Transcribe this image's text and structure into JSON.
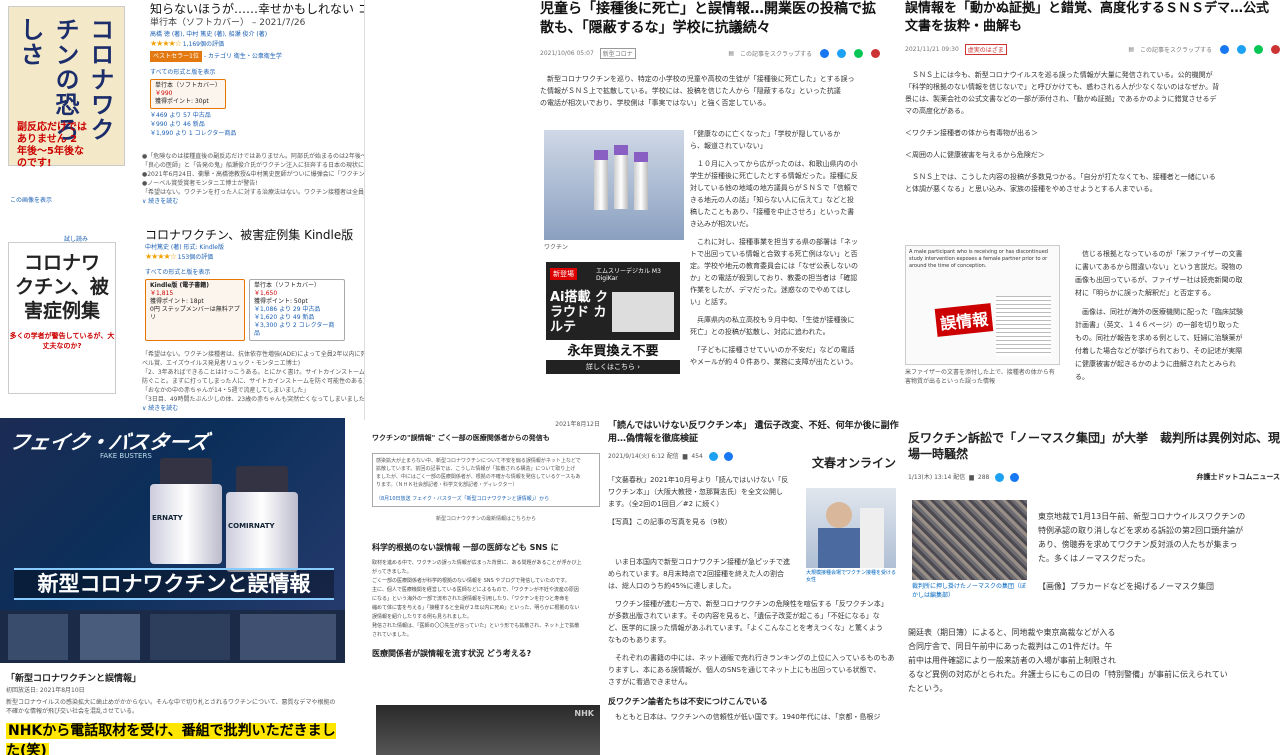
{
  "panelA": {
    "book1": {
      "cover_title": "コロナワクチンの恐ろしさ",
      "cover_sub": "副反応だけではありません 2年後～5年後なのです!",
      "title": "知らないほうが……幸せかもしれない コロナワクチンの恐ろしさ",
      "format_line": "単行本（ソフトカバー） – 2021/7/26",
      "authors": "高橋 徳 (著), 中村 篤史 (著), 船瀬 俊介 (著)",
      "rating_count": "1,169個の評価",
      "badge": "ベストセラー1位",
      "category": "- カテゴリ 衛生・公衆衛生学",
      "all_formats": "すべての形式と版を表示",
      "format_box": "単行本（ソフトカバー）",
      "price": "￥990",
      "points": "獲得ポイント: 30pt",
      "used": [
        "￥469 より 57 中古品",
        "￥990 より 46 新品",
        "￥1,990 より 1 コレクター商品"
      ],
      "desc": [
        "●「危険なのは接種直後の副反応だけではありません。阿部氏が始まるのは2年後～5年後なのです!」…危険性を叫ぶ2人の",
        "「良心の医師」と「告発の鬼」船瀬俊介氏がワクチン注入に狂奔する日本の現状に心底から警鐘：コロナワクチンの安全性への重大",
        "●2021年6月24日、衝撃・高橋徳教授&中村篤史医師がついに爆弾会に「ワクチン接種停止」を緊急申し入れ!",
        "●ノーベル賞受賞者モンタニエ博士が警告!",
        "「希望はない。ワクチンを打った人に対する治療法はない。ワクチン接種者は全員2年以内に死ぬ…"
      ],
      "more": "∨ 続きを読む",
      "see_image": "この画像を表示"
    },
    "book2": {
      "sample_label": "試し読み",
      "cover_title": "コロナワクチン、被害症例集",
      "cover_sub": "多くの学者が警告しているが、大丈夫なのか?",
      "title": "コロナワクチン、被害症例集 Kindle版",
      "authors": "中村篤史 (著)   形式: Kindle版",
      "rating_count": "153個の評価",
      "all_formats": "すべての形式と版を表示",
      "kindle_box": "Kindle版 (電子書籍)",
      "kindle_price": "￥1,815",
      "kindle_points": "獲得ポイント: 18pt",
      "unlimited": "0円 ステップメンバーは無料アプリ",
      "paper_box": "単行本（ソフトカバー）",
      "paper_price": "￥1,650",
      "paper_points": "獲得ポイント: 50pt",
      "used": [
        "￥1,086 より 29 中古品",
        "￥1,620 より 49 新品",
        "￥3,300 より 2 コレクター商品"
      ],
      "desc": [
        "「希望はない。ワクチン接種者は、抗体依存性増強(ADE)によって全員2年以内に死亡する。もはや他に話すべきことはない」(ノー",
        "ベル賞、エイズウイルス発見者リュック・モンタニエ博士)",
        "「2、3年あればできることはけっこうある。とにかく書け。サイトカインストームを抑え込むために、免疫の改善によって発症を",
        "防ぐこと。まずに打ってしまった人に、サイトカインストームを防ぐ可能性のある方法を紹介します」(中村篤史)",
        "「おなかの中の赤ちゃんが14・5週で流産してしまいました」",
        "「3日目、49時間たぶん少しの体、23歳の赤ちゃんも突然亡くなってしまいました」"
      ],
      "more": "∨ 続きを読む"
    }
  },
  "panelB": {
    "headline": "児童ら「接種後に死亡」と誤情報…開業医の投稿で拡散も、「隠蔽するな」学校に抗議続々",
    "date": "2021/10/06 05:07",
    "tag": "新型コロナ",
    "clip": "この記事をスクラップする",
    "lead": [
      "　新型コロナワクチンを巡り、特定の小学校の児童や高校の生徒が「接種後に死亡した」とする誤っ",
      "た情報がＳＮＳ上で拡散している。学校には、投稿を信じた人から「隠蔽するな」といった抗議",
      "の電話が相次いでおり、学校側は「事実ではない」と強く否定している。"
    ],
    "body": [
      "「健康なのに亡くなった」「学校が隠しているか",
      "ら、報道されていない」",
      "",
      "　１０月に入ってから広がったのは、和歌山県内の小",
      "学生が接種後に死亡したとする情報だった。接種に反",
      "対している他の地域の地方議員らがＳＮＳで「信頼で",
      "きる地元の人の話」「知らない人に伝えて」などと投",
      "稿したこともあり、「接種を中止させろ」といった書",
      "き込みが相次いだ。",
      "",
      "　これに対し、接種事業を担当する県の部署は「ネッ",
      "トで出回っている情報と合致する死亡例はない」と否",
      "定。学校や地元の教育委員会には「なぜ公表しないの",
      "か」との電話が殺到しており、教委の担当者は「確認",
      "作業をしたが、デマだった。迷惑なのでやめてほし",
      "い」と話す。",
      "",
      "　兵庫県内の私立高校も９月中旬、「生徒が接種後に",
      "死亡」との投稿が拡散し、対応に追われた。",
      "",
      "　「子どもに接種させていいのか不安だ」などの電話",
      "やメールが約４０件あり、業務に支障が出たという。"
    ],
    "photo_caption": "ワクチン",
    "ad_new": "新登場",
    "ad_brand": "エムスリーデジカル M3 DigiKar",
    "ad_main": "Ai搭載 クラウド カルテ",
    "ad_slogan": "永年買換え不要",
    "ad_more": "詳しくはこちら ›"
  },
  "panelC": {
    "headline": "誤情報を「動かぬ証拠」と錯覚、高度化するＳＮＳデマ…公式文書を抜粋・曲解も",
    "date": "2021/11/21 09:30",
    "tag": "虚実のはざま",
    "clip": "この記事をスクラップする",
    "lead": [
      "　ＳＮＳ上には今も、新型コロナウイルスを巡る誤った情報が大量に発信されている。公的機関が",
      "「科学的根拠のない情報を信じないで」と呼びかけても、惑わされる人が少なくないのはなぜか。背",
      "景には、製薬会社の公式文書などの一部が添付され、「動かぬ証拠」であるかのように錯覚させるデ",
      "マの高度化がある。"
    ],
    "quotes": [
      "＜ワクチン接種者の体から有毒物が出る＞",
      "＜周囲の人に健康被害を与えるから危険だ＞"
    ],
    "para2": [
      "　ＳＮＳ上では、こうした内容の投稿が多数見つかる。「自分が打たなくても、接種者と一緒にいる",
      "と体調が悪くなる」と思い込み、家族の接種をやめさせようとする人までいる。"
    ],
    "doc_text": "A male participant who is receiving or has discontinued study intervention exposes a female partner prior to or around the time of conception.",
    "doc_stamp": "誤情報",
    "doc_caption": "米ファイザーの文書を添付した上で、接種者の体から有害物質が出るといった誤った情報",
    "right_text": [
      "　信じる根拠となっているのが「米ファイザーの文書",
      "に書いてあるから間違いない」という言説だ。現物の",
      "画像も出回っているが、ファイザー社は読売新聞の取",
      "材に「明らかに誤った解釈だ」と否定する。",
      "",
      "　画像は、同社が海外の医療機関に配った「臨床試験",
      "計画書」（英文、１４６ページ）の一部を切り取った",
      "もの。同社が報告を求める例として、妊婦に治験薬が",
      "付着した場合などが挙げられており、その記述が実際",
      "に健康被害が起きるかのように曲解されたとみられ",
      "る。"
    ]
  },
  "panelD": {
    "logo": "フェイク・バスターズ",
    "logo_en": "FAKE BUSTERS",
    "vial1": "ERNATY",
    "vial2": "COMIRNATY",
    "banner": "新型コロナワクチンと誤情報",
    "program_title": "「新型コロナワクチンと誤情報」",
    "date": "初回放送日: 2021年8月10日",
    "desc": "新型コロナウイルスの感染拡大に歯止めがかからない。そんな中で切り札とされるワクチンについて、悪質なデマや根拠の不確かな情報が飛び交い社会を混乱させている。",
    "highlight": "NHKから電話取材を受け、番組で批判いただきました(笑)"
  },
  "panelE": {
    "date": "2021年8月12日",
    "title": "ワクチンの\"誤情報\" ごく一部の医療関係者からの発信も",
    "box": [
      "感染拡大が止まらない中、新型コロナワクチンについて不安を煽る誤情報がネット上などで",
      "拡散しています。前回の記事では、こうした情報が「拡散される構造」について取り上げ",
      "ましたが、中にはごく一部の医療関係者が、根拠の不確かな情報を発信しているケースもあ",
      "ります。（ＮＨＫ社会部記者・科学文化部記者・ディレクター）"
    ],
    "box_footer": "（8月10日放送 フェイク・バスターズ「新型コロナワクチンと誤情報」）から",
    "latest": "新型コロナウクチンの最新情報はこちらから",
    "section": "科学的根拠のない誤情報 一部の医師なども SNS に",
    "text": [
      "取材を進める中で、ワクチンの誤った情報が広まった背景に、ある問題があることが浮かび上",
      "がってきました。",
      "ごく一部の医療関係者が科学的根拠のない情報を SNS やブログで発信していたのです。",
      "主に、個人で医療機関を経営している医師などによるもので、「ワクチンが不妊や流産の原因",
      "になる」という海外の一部で流布された誤情報を引用したり、「ワクチンを打つと寿命を",
      "縮めて体に害を与える」「接種すると全員が２年以内に死ぬ」といった、明らかに根拠のない",
      "誤情報を紹介したりする例も見られました。",
      "発信された情報は、「医師の〇〇先生が言っていた」という形でも拡散され、ネット上で拡散",
      "されていました。"
    ],
    "section2": "医療関係者が誤情報を流す状況 どう考える?",
    "photo_label": "NHK"
  },
  "panelF": {
    "headline": "「読んではいけない反ワクチン本」 遺伝子改変、不妊、何年か後に副作用…偽情報を徹底検証",
    "date": "2021/9/14(火) 6:12 配信",
    "count": "454",
    "brand": "文春オンライン",
    "lead": [
      "「文藝春秋」2021年10月号より「読んではいけない「反",
      "ワクチン本」」（大阪大教授・忽那賢志氏）を全文公開し",
      "ます。（全2回の1回目／#2 に続く）"
    ],
    "photo_link": "【写真】この記事の写真を見る（9枚）",
    "photo_caption": "大規模接種会場でワクチン接種を受ける女性",
    "body": [
      "　いま日本国内で新型コロナワクチン接種が急ピッチで進",
      "められています。8月末時点で2回接種を終えた人の割合",
      "は、総人口のうち約45%に達しました。",
      "",
      "　ワクチン接種が進む一方で、新型コロナワクチンの危険性を喧伝する「反ワクチン本」",
      "が多数出版されています。その内容を見ると、「遺伝子改変が起こる」「不妊になる」な",
      "ど、医学的に誤った情報があふれています。「よくこんなことを考えつくな」と驚くよう",
      "なものもあります。",
      "",
      "　それぞれの書籍の中には、ネット通販で売れ行きランキングの上位に入っているものもあ",
      "りますし、本にある誤情報が、個人のSNSを通じてネット上にも出回っている状態で、",
      "さすがに看過できません。"
    ],
    "section": "反ワクチン論者たちは不安につけこんでいる",
    "last": "　もともと日本は、ワクチンへの信頼性が低い国です。1940年代には、「京都・島根ジ"
  },
  "panelG": {
    "headline": "反ワクチン訴訟で「ノーマスク集団」が大挙　裁判所は異例対応、現場一時騒然",
    "date": "1/13(木) 13:14 配信",
    "count": "288",
    "brand": "弁護士ドットコムニュース",
    "photo_caption": "裁判所に押し掛けたノーマスクの集団（ぼかしは編集部）",
    "side_text": [
      "東京地裁で1月13日午前、新型コロナウイルスワクチンの",
      "特例承認の取り消しなどを求める訴訟の第2回口頭弁論が",
      "あり、傍聴券を求めてワクチン反対派の人たちが集まっ",
      "た。多くはノーマスクだった。"
    ],
    "photo_link": "【画像】プラカードなどを掲げるノーマスク集団",
    "body": [
      "開廷表（期日簿）によると、同地裁や東京高裁などが入る",
      "合同庁舎で、同日午前中にあった裁判はこの1件だけ。午",
      "前中は用件確認により一般来訪者の入場が事前上制限され",
      "るなど異例の対応がとられた。弁護士らにもこの日の「特別警備」が事前に伝えられてい",
      "たという。"
    ]
  }
}
